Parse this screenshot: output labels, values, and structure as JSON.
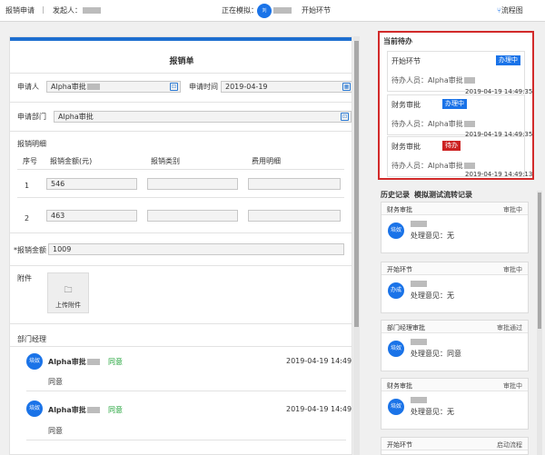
{
  "topbar": {
    "form_name": "报销申请",
    "initiator_label": "发起人：",
    "simulating_label": "正在模拟：",
    "avatar_text": "刘",
    "start_label": "开始环节",
    "flow_chart_label": "流程图"
  },
  "form": {
    "title": "报销单",
    "applicant_label": "申请人",
    "applicant_value": "Alpha审批",
    "date_label": "申请时间",
    "date_value": "2019-04-19",
    "dept_label": "申请部门",
    "dept_value": "Alpha审批",
    "details_label": "报销明细",
    "columns": [
      "序号",
      "报销金额(元)",
      "报销类别",
      "费用明细"
    ],
    "rows": [
      {
        "index": "1",
        "amount": "546"
      },
      {
        "index": "2",
        "amount": "463"
      }
    ],
    "total_label": "*报销金额",
    "total_value": "1009",
    "attachment_label": "附件",
    "upload_label": "上传附件",
    "manager_label": "部门经理",
    "approvals": [
      {
        "avatar": "培奴",
        "name": "Alpha审批",
        "result": "同意",
        "time": "2019-04-19 14:49",
        "opinion": "同意"
      },
      {
        "avatar": "培奴",
        "name": "Alpha审批",
        "result": "同意",
        "time": "2019-04-19 14:49",
        "opinion": "同意"
      }
    ]
  },
  "pending": {
    "title": "当前待办",
    "items": [
      {
        "name": "开始环节",
        "badge": "办理中",
        "badge_color": "#1a73e8",
        "handler": "待办人员：Alpha审批",
        "time": "2019-04-19 14:49:35"
      },
      {
        "name": "财务审批",
        "badge": "办理中",
        "badge_color": "#1a73e8",
        "handler": "待办人员：Alpha审批",
        "time": "2019-04-19 14:49:35"
      },
      {
        "name": "财务审批",
        "badge": "待办",
        "badge_color": "#cc2222",
        "handler": "待办人员：Alpha审批",
        "time": "2019-04-19 14:49:13"
      }
    ]
  },
  "history": {
    "tab_history": "历史记录",
    "tab_simulation": "模拟测试流转记录",
    "items": [
      {
        "name": "财务审批",
        "status": "审批中",
        "avatar": "培奴",
        "opinion": "处理意见：无"
      },
      {
        "name": "开始环节",
        "status": "审批中",
        "avatar": "办成",
        "opinion": "处理意见：无"
      },
      {
        "name": "部门经理审批",
        "status": "审批通过",
        "avatar": "培奴",
        "opinion": "处理意见：同意"
      },
      {
        "name": "财务审批",
        "status": "审批中",
        "avatar": "培奴",
        "opinion": "处理意见：无"
      },
      {
        "name": "开始环节",
        "status": "启动流程",
        "avatar": "",
        "opinion": ""
      }
    ]
  }
}
